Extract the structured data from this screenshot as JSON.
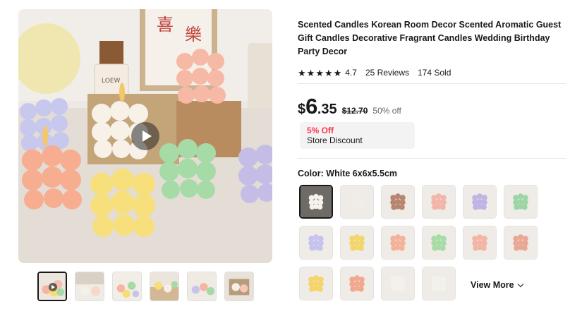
{
  "product": {
    "title": "Scented Candles Korean Room Decor Scented Aromatic Guest Gift Candles Decorative Fragrant Candles Wedding Birthday Party Decor",
    "rating": "4.7",
    "reviews": "25 Reviews",
    "sold": "174 Sold",
    "stars": 5
  },
  "price": {
    "currency": "$",
    "int": "6",
    "dec": ".35",
    "original": "$12.70",
    "off": "50% off"
  },
  "discount": {
    "headline": "5% Off",
    "label": "Store Discount"
  },
  "color": {
    "label": "Color:",
    "selected": "White 6x6x5.5cm"
  },
  "view_more": "View More",
  "gallery": {
    "thumb_count": 6
  },
  "swatch_colors": [
    [
      "#f4f0ea",
      "#f1ede6",
      "#b88670",
      "#f2b5a7",
      "#c1b3e3",
      "#9ed5a6"
    ],
    [
      "#c6c4ee",
      "#f2d66b",
      "#f4b29a",
      "#a8dca6",
      "#f3b5a6",
      "#e9a894"
    ],
    [
      "#f5d56b",
      "#f1a88f",
      "#f4f1ec",
      "#f3f1ec"
    ]
  ],
  "colors": {
    "accent_red": "#fd384f",
    "text": "#191919",
    "muted": "#666666",
    "discount_bg": "#f3f3f3"
  }
}
